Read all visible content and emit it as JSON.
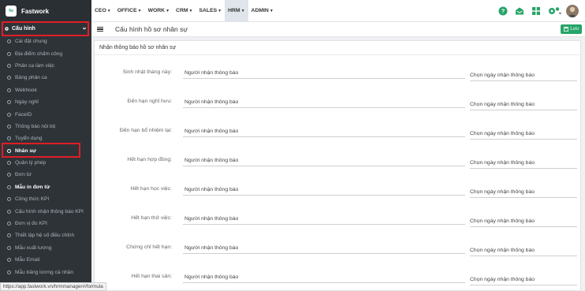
{
  "brand": {
    "name": "Fastwork",
    "logo_text": "fw"
  },
  "sidebar": {
    "section_label": "Cấu hình",
    "items": [
      {
        "label": "Cài đặt chung"
      },
      {
        "label": "Địa điểm chấm công"
      },
      {
        "label": "Phân ca làm việc"
      },
      {
        "label": "Bảng phân ca"
      },
      {
        "label": "Webhook"
      },
      {
        "label": "Ngày nghỉ"
      },
      {
        "label": "FaceID"
      },
      {
        "label": "Thông báo nội bộ"
      },
      {
        "label": "Tuyển dụng"
      },
      {
        "label": "Nhân sự"
      },
      {
        "label": "Quản lý phép"
      },
      {
        "label": "Đơn từ"
      },
      {
        "label": "Mẫu in đơn từ"
      },
      {
        "label": "Công thức KPI"
      },
      {
        "label": "Cấu hình nhận thông báo KPI"
      },
      {
        "label": "Đơn vị đo KPI"
      },
      {
        "label": "Thiết lập hệ số điều chỉnh"
      },
      {
        "label": "Mẫu xuất lương"
      },
      {
        "label": "Mẫu Email"
      },
      {
        "label": "Mẫu bảng lương cá nhân"
      }
    ]
  },
  "topnav": {
    "items": [
      {
        "label": "CEO"
      },
      {
        "label": "OFFICE"
      },
      {
        "label": "WORK"
      },
      {
        "label": "CRM"
      },
      {
        "label": "SALES"
      },
      {
        "label": "HRM"
      },
      {
        "label": "ADMIN"
      }
    ],
    "icons": [
      "help-icon",
      "mail-icon",
      "apps-grid-icon",
      "settings-icon"
    ]
  },
  "page": {
    "title": "Cấu hình hồ sơ nhân sự",
    "save_label": "Lưu",
    "panel_title": "Nhận thông báo hồ sơ nhân sự",
    "input_placeholder": "Người nhận thông báo",
    "date_placeholder": "Chọn ngày nhận thông báo",
    "rows": [
      {
        "label": "Sinh nhật tháng này:"
      },
      {
        "label": "Đến hạn nghỉ hưu:"
      },
      {
        "label": "Đến hạn bổ nhiệm lại:"
      },
      {
        "label": "Hết hạn hợp đồng:"
      },
      {
        "label": "Hết hạn học việc:"
      },
      {
        "label": "Hết hạn thử việc:"
      },
      {
        "label": "Chứng chỉ hết hạn:"
      },
      {
        "label": "Hết hạn thai sản:"
      }
    ]
  },
  "statusbar": {
    "url": "https://app.fastwork.vn/hrmmanager#/formula"
  },
  "colors": {
    "sidebar_bg": "#2e3338",
    "accent_green": "#27a468",
    "highlight_red": "#e01e25"
  }
}
